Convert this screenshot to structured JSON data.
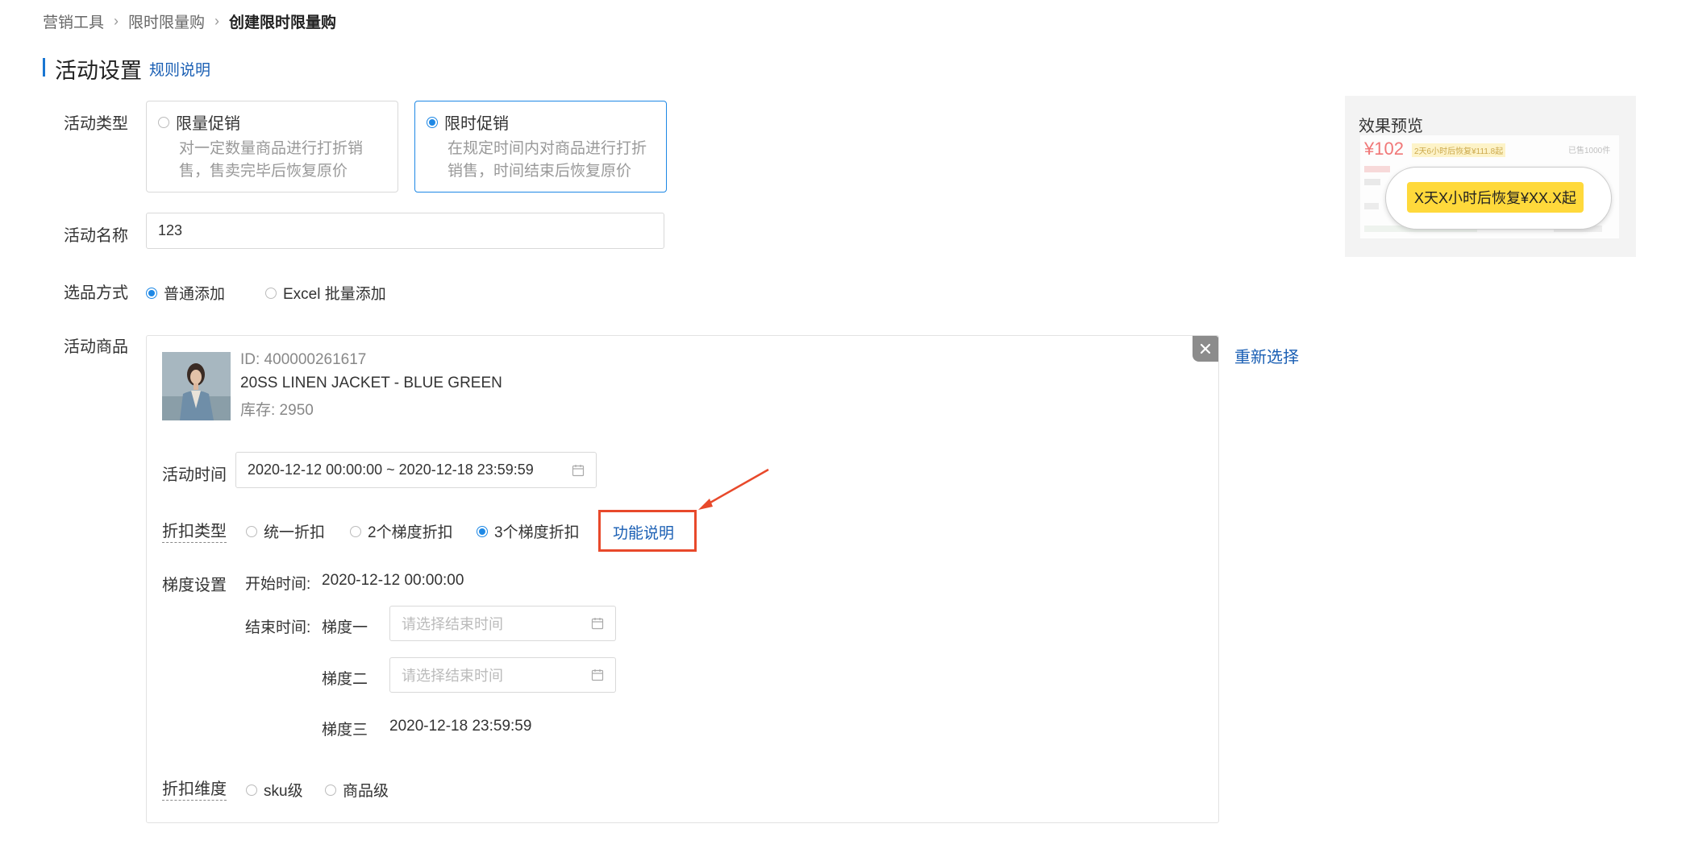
{
  "breadcrumb": {
    "item1": "营销工具",
    "item2": "限时限量购",
    "current": "创建限时限量购"
  },
  "section": {
    "title": "活动设置",
    "rule_link": "规则说明"
  },
  "form": {
    "activity_type_label": "活动类型",
    "type_cards": [
      {
        "title": "限量促销",
        "desc": "对一定数量商品进行打折销售，售卖完毕后恢复原价",
        "selected": false
      },
      {
        "title": "限时促销",
        "desc": "在规定时间内对商品进行打折销售，时间结束后恢复原价",
        "selected": true
      }
    ],
    "activity_name_label": "活动名称",
    "activity_name_value": "123",
    "selection_label": "选品方式",
    "selection_options": [
      "普通添加",
      "Excel 批量添加"
    ],
    "selection_selected": 0,
    "goods_label": "活动商品"
  },
  "product": {
    "id_text": "ID: 400000261617",
    "name": "20SS LINEN JACKET - BLUE GREEN",
    "stock": "库存: 2950",
    "activity_time_label": "活动时间",
    "activity_time_value": "2020-12-12 00:00:00 ~ 2020-12-18 23:59:59",
    "discount_type_label": "折扣类型",
    "discount_options": [
      "统一折扣",
      "2个梯度折扣",
      "3个梯度折扣"
    ],
    "discount_selected": 2,
    "func_link": "功能说明",
    "gradient_label": "梯度设置",
    "start_time_label": "开始时间:",
    "start_time_value": "2020-12-12 00:00:00",
    "end_time_label": "结束时间:",
    "tiers": [
      {
        "label": "梯度一",
        "placeholder": "请选择结束时间"
      },
      {
        "label": "梯度二",
        "placeholder": "请选择结束时间"
      },
      {
        "label": "梯度三",
        "value": "2020-12-18 23:59:59"
      }
    ],
    "dimension_label": "折扣维度",
    "dimension_options": [
      "sku级",
      "商品级"
    ]
  },
  "reselect": "重新选择",
  "preview": {
    "title": "效果预览",
    "price": "¥102",
    "tag_small": "2天6小时后恢复¥111.8起",
    "sold": "已售1000件",
    "bubble_text": "X天X小时后恢复¥XX.X起"
  },
  "colors": {
    "accent": "#1e88e5",
    "link": "#1a5fb4",
    "highlight": "#e8492b",
    "tag": "#ffd93b"
  }
}
